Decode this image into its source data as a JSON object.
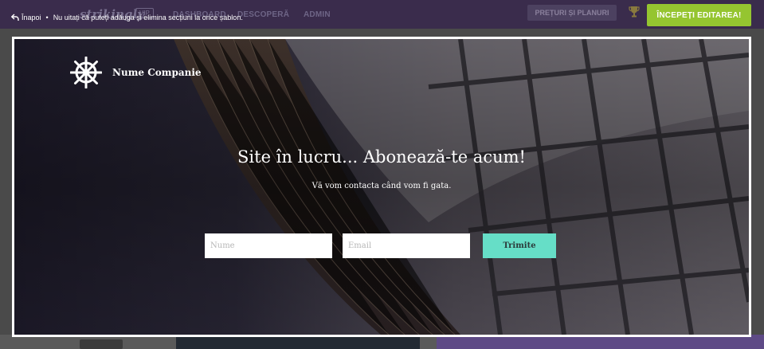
{
  "topbar": {
    "logo": "strikingly",
    "vip": "VIP",
    "nav": [
      "DASHBOARD",
      "DESCOPERĂ",
      "ADMIN"
    ],
    "pricing_label": "PREȚURI ȘI PLANURI",
    "start_label": "ÎNCEPEȚI EDITAREA!"
  },
  "notice": {
    "back_label": "Înapoi",
    "bullet": "•",
    "message": "Nu uitați că puteți adăuga și elimina secțiuni la orice șablon."
  },
  "hero": {
    "company_name": "Nume Companie",
    "title": "Site în lucru... Abonează-te acum!",
    "subtitle": "Vă vom contacta când vom fi gata.",
    "name_placeholder": "Nume",
    "email_placeholder": "Email",
    "submit_label": "Trimite"
  },
  "colors": {
    "topbar": "#3a2c4c",
    "start_button": "#95c530",
    "submit_button": "#66dec7"
  },
  "icons": [
    "back-arrow-icon",
    "trophy-icon",
    "ship-wheel-icon"
  ]
}
